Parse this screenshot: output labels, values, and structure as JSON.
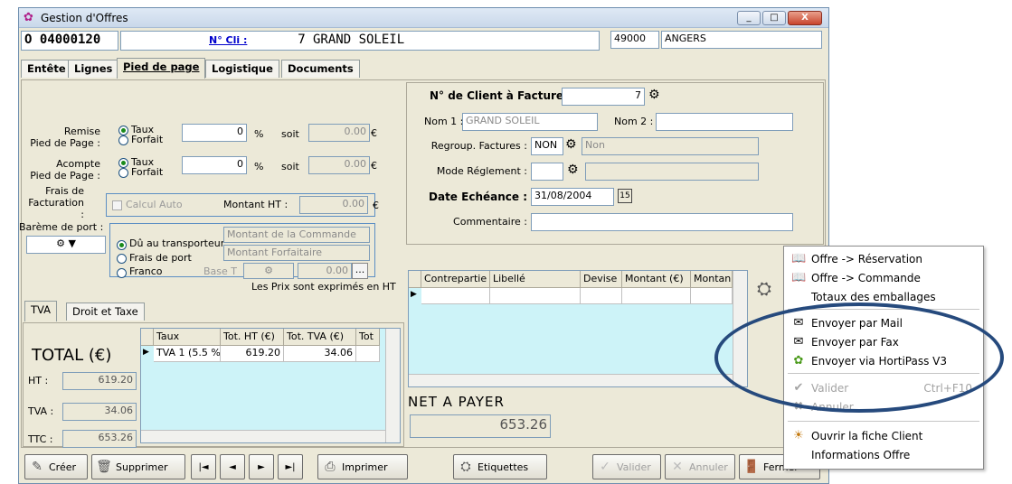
{
  "window": {
    "title": "Gestion d'Offres",
    "icon": "flower-app-icon",
    "min_label": "_",
    "max_label": "□",
    "close_label": "X"
  },
  "header": {
    "offer_number": "O 04000120",
    "client_link": "N° Cli :",
    "client_number": "7",
    "client_name": "GRAND SOLEIL",
    "postal_code": "49000",
    "city": "ANGERS"
  },
  "tabs": [
    "Entête",
    "Lignes",
    "Pied de page",
    "Logistique",
    "Documents"
  ],
  "footer_form": {
    "remise_label": "Remise\nPied de Page :",
    "acompte_label": "Acompte\nPied de Page :",
    "taux_label": "Taux",
    "forfait_label": "Forfait",
    "remise_value": "0",
    "acompte_value": "0",
    "percent": "%",
    "soit": "soit",
    "remise_soit": "0.00",
    "acompte_soit": "0.00",
    "euro": "€",
    "frais_label": "Frais de\nFacturation :",
    "calcul_auto": "Calcul Auto",
    "montant_ht_label": "Montant HT :",
    "montant_ht_value": "0.00",
    "bareme_label": "Barème de port :",
    "port_options": [
      "Dû au transporteur",
      "Frais de port",
      "Franco"
    ],
    "port_select1": "Montant de la Commande",
    "port_select2": "Montant Forfaitaire",
    "base_t": "Base T",
    "base_value": "0.00",
    "ellipsis": "...",
    "prix_note": "Les Prix sont exprimés en HT"
  },
  "invoice": {
    "client_label": "N° de Client à Facturer :",
    "client_value": "7",
    "nom1_label": "Nom 1 :",
    "nom1_value": "GRAND SOLEIL",
    "nom2_label": "Nom 2 :",
    "nom2_value": "",
    "regroup_label": "Regroup. Factures :",
    "regroup_value": "NON",
    "regroup_text": "Non",
    "mode_label": "Mode Réglement :",
    "echeance_label": "Date Echéance :",
    "echeance_value": "31/08/2004",
    "calendar_icon": "15",
    "commentaire_label": "Commentaire :"
  },
  "contrepartie_grid": {
    "headers": [
      "Contrepartie",
      "Libellé",
      "Devise",
      "Montant (€)",
      "Montan"
    ]
  },
  "tva_tabs": [
    "TVA",
    "Droit et Taxe"
  ],
  "totals": {
    "title": "TOTAL",
    "currency": "(€)",
    "ht_label": "HT :",
    "ht_value": "619.20",
    "tva_label": "TVA :",
    "tva_value": "34.06",
    "ttc_label": "TTC :",
    "ttc_value": "653.26"
  },
  "tva_grid": {
    "headers": [
      "Taux",
      "Tot. HT (€)",
      "Tot. TVA (€)",
      "Tot"
    ],
    "rows": [
      [
        "TVA 1 (5.5 %",
        "619.20",
        "34.06",
        ""
      ]
    ]
  },
  "net": {
    "label": "NET A PAYER",
    "value": "653.26"
  },
  "buttons": {
    "creer": "Créer",
    "supprimer": "Supprimer",
    "first": "|◄",
    "prev": "◄",
    "next": "►",
    "last": "►|",
    "imprimer": "Imprimer",
    "etiquettes": "Etiquettes",
    "valider": "Valider",
    "annuler": "Annuler",
    "fermer": "Fermer"
  },
  "context_menu": {
    "items": [
      {
        "label": "Offre -> Réservation",
        "icon": "book-icon",
        "enabled": true
      },
      {
        "label": "Offre -> Commande",
        "icon": "book-icon",
        "enabled": true
      },
      {
        "label": "Totaux des emballages",
        "icon": "",
        "enabled": true
      },
      {
        "label": "Envoyer par Mail",
        "icon": "send-icon",
        "enabled": true
      },
      {
        "label": "Envoyer par Fax",
        "icon": "send-icon",
        "enabled": true
      },
      {
        "label": "Envoyer via HortiPass V3",
        "icon": "hortipass-icon",
        "enabled": true
      },
      {
        "label": "Valider",
        "shortcut": "Ctrl+F10",
        "icon": "check-icon",
        "enabled": false
      },
      {
        "label": "Annuler",
        "icon": "cross-icon",
        "enabled": false
      },
      {
        "label": "Ouvrir la fiche Client",
        "icon": "client-icon",
        "enabled": true
      },
      {
        "label": "Informations Offre",
        "icon": "",
        "enabled": true
      }
    ]
  },
  "colors": {
    "window_bg": "#ece9d8",
    "grid_bg": "#cdf3f8",
    "highlight_ellipse": "#264a7d",
    "link_blue": "#0000cc"
  }
}
